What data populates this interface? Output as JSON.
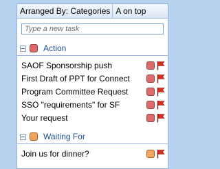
{
  "header": {
    "arranged_by": "Arranged By: Categories",
    "sort": "A on top"
  },
  "new_task": {
    "placeholder": "Type a new task"
  },
  "groups": [
    {
      "label": "Action",
      "color": "#e06a6a",
      "tasks": [
        {
          "subject": "SAOF Sponsorship push"
        },
        {
          "subject": "First Draft of PPT for Connect"
        },
        {
          "subject": "Program Committee Request"
        },
        {
          "subject": "SSO \"requirements\" for SF"
        },
        {
          "subject": "Your request"
        }
      ]
    },
    {
      "label": "Waiting For",
      "color": "#f2a45a",
      "tasks": [
        {
          "subject": "Join us for dinner?"
        }
      ]
    }
  ],
  "colors": {
    "flag": "#d7301f",
    "pane_border": "#8fb0d8",
    "group_text": "#1e4e8c"
  }
}
